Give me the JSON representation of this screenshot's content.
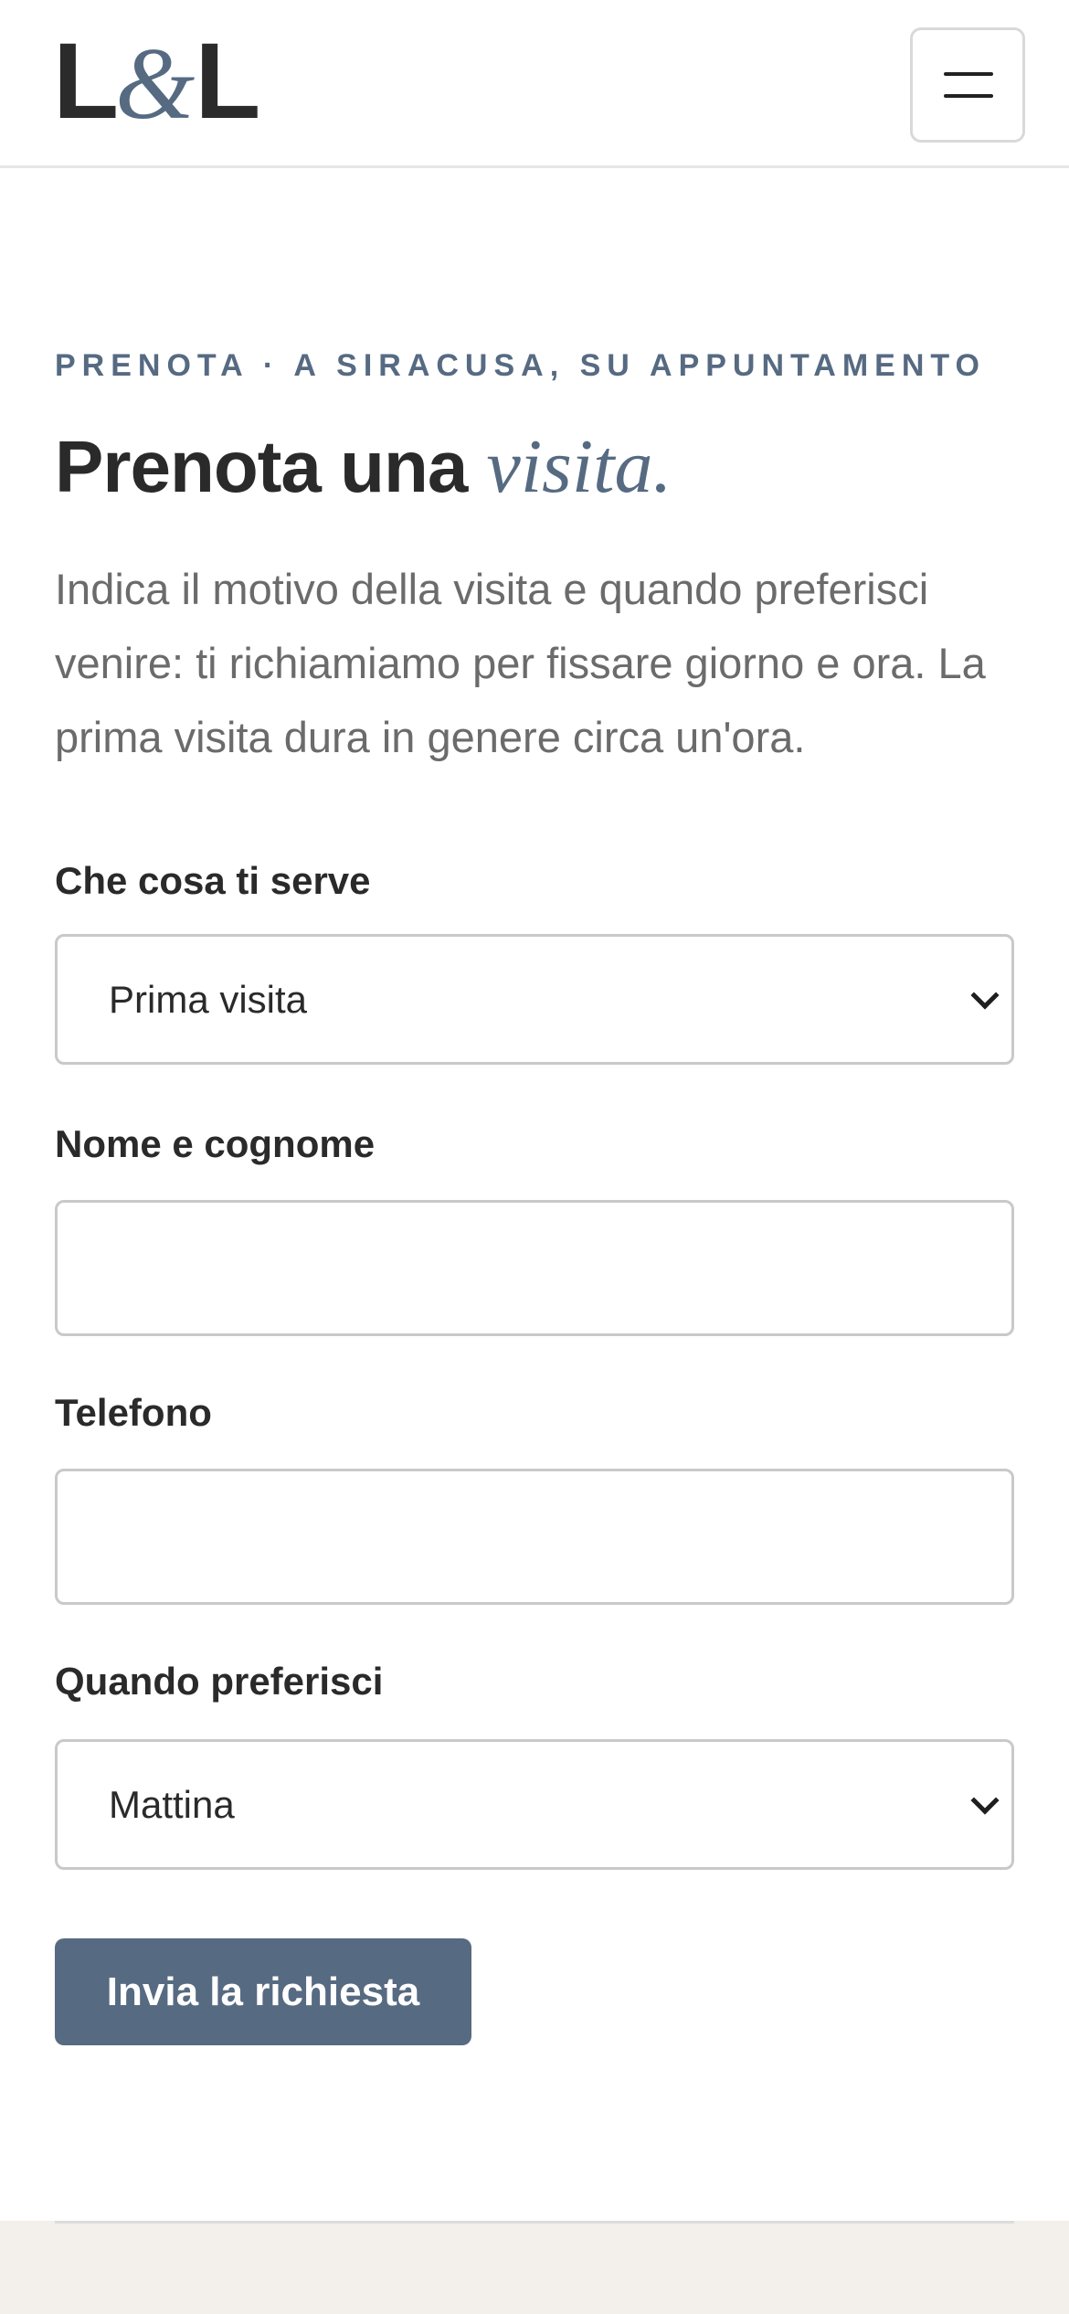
{
  "header": {
    "logo_left": "L",
    "logo_amp": "&",
    "logo_right": "L",
    "menu_icon": "hamburger-menu-icon"
  },
  "hero": {
    "eyebrow": "PRENOTA · A SIRACUSA, SU APPUNTAMENTO",
    "title_main": "Prenota una ",
    "title_accent": "visita.",
    "intro": "Indica il motivo della visita e quando preferisci venire: ti richiamiamo per fissare giorno e ora. La prima visita dura in genere circa un'ora."
  },
  "form": {
    "service": {
      "label": "Che cosa ti serve",
      "selected": "Prima visita"
    },
    "name": {
      "label": "Nome e cognome",
      "value": ""
    },
    "phone": {
      "label": "Telefono",
      "value": ""
    },
    "preference": {
      "label": "Quando preferisci",
      "selected": "Mattina"
    },
    "submit_label": "Invia la richiesta"
  },
  "colors": {
    "accent": "#566a82",
    "text": "#2a2a2a",
    "muted_text": "#6b6b6b",
    "footer_bg": "#f3f0eb"
  }
}
